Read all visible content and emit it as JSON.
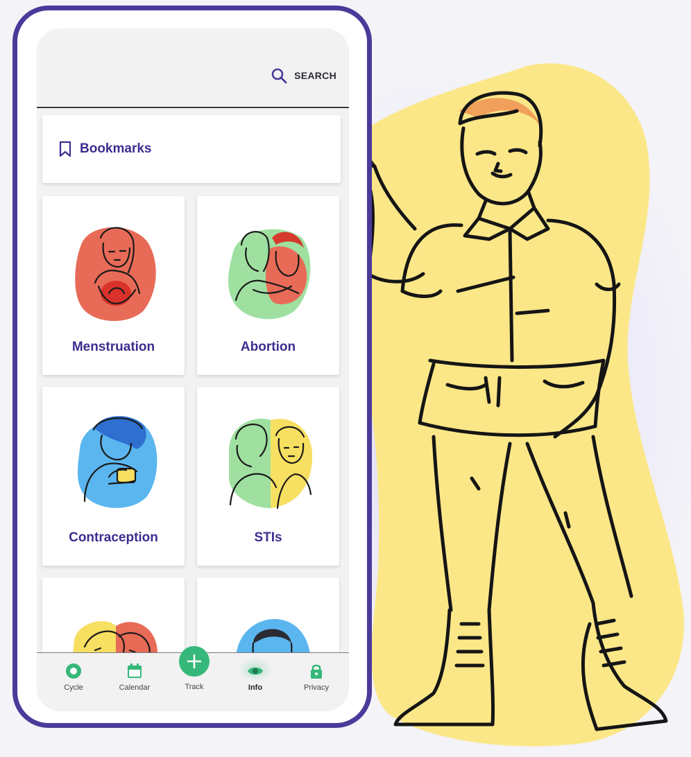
{
  "header": {
    "search_label": "SEARCH"
  },
  "bookmarks": {
    "label": "Bookmarks"
  },
  "topics": [
    {
      "label": "Menstruation"
    },
    {
      "label": "Abortion"
    },
    {
      "label": "Contraception"
    },
    {
      "label": "STIs"
    },
    {
      "label": ""
    },
    {
      "label": ""
    }
  ],
  "bottom_nav": {
    "items": [
      {
        "label": "Cycle",
        "icon": "cycle-icon"
      },
      {
        "label": "Calendar",
        "icon": "calendar-icon"
      },
      {
        "label": "Track",
        "icon": "plus-icon"
      },
      {
        "label": "Info",
        "icon": "eye-icon",
        "active": true
      },
      {
        "label": "Privacy",
        "icon": "lock-icon"
      }
    ]
  },
  "colors": {
    "phone_frame": "#4b3a99",
    "accent_text": "#3e2d8f",
    "nav_green": "#35b87a",
    "illustration_yellow": "#fbe787",
    "blob_red": "#e86b57",
    "blob_green": "#9fe0a0",
    "blob_blue": "#5bb6ef",
    "blob_yellow": "#f7df61"
  }
}
